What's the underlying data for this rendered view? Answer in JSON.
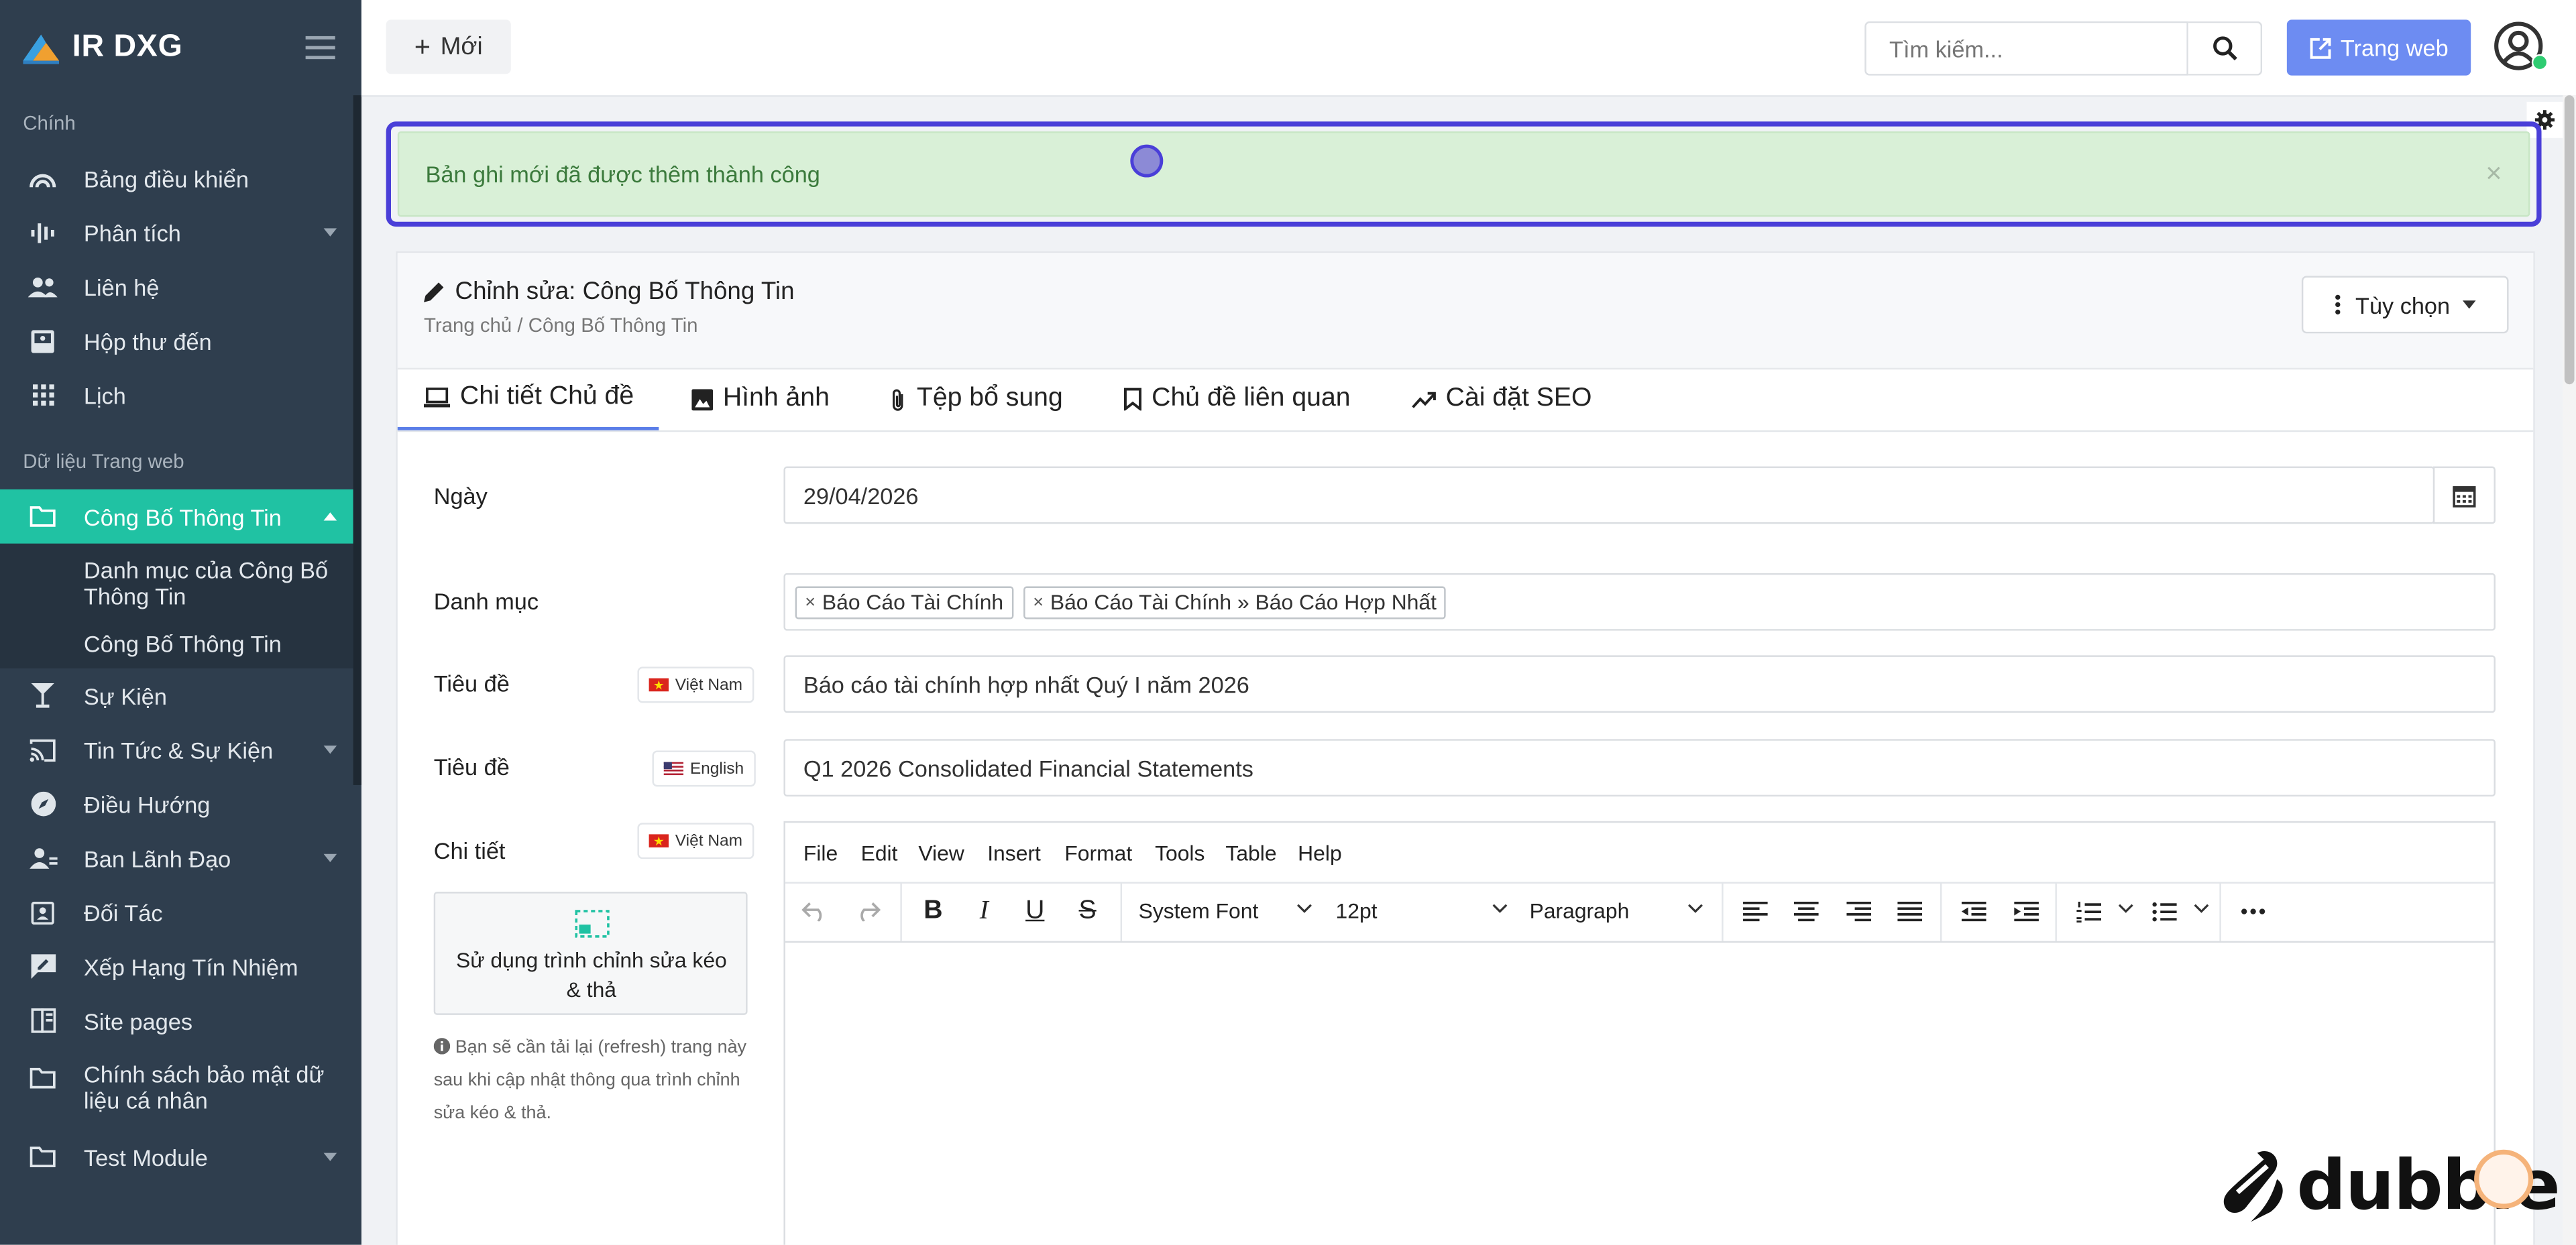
{
  "app": {
    "name": "IR DXG"
  },
  "sidebar": {
    "section_main": "Chính",
    "section_web": "Dữ liệu Trang web",
    "items": [
      {
        "label": "Bảng điều khiển",
        "icon": "dashboard-gauge-icon"
      },
      {
        "label": "Phân tích",
        "icon": "analytics-wave-icon",
        "expandable": true
      },
      {
        "label": "Liên hệ",
        "icon": "contacts-users-icon"
      },
      {
        "label": "Hộp thư đến",
        "icon": "inbox-icon"
      },
      {
        "label": "Lịch",
        "icon": "calendar-grid-icon"
      },
      {
        "label": "Công Bố Thông Tin",
        "icon": "folder-icon",
        "expandable": true,
        "active": true
      },
      {
        "label": "Sự Kiện",
        "icon": "cocktail-icon"
      },
      {
        "label": "Tin Tức & Sự Kiện",
        "icon": "cast-icon",
        "expandable": true
      },
      {
        "label": "Điều Hướng",
        "icon": "compass-icon"
      },
      {
        "label": "Ban Lãnh Đạo",
        "icon": "team-icon",
        "expandable": true
      },
      {
        "label": "Đối Tác",
        "icon": "id-card-icon"
      },
      {
        "label": "Xếp Hạng Tín Nhiệm",
        "icon": "rating-chat-icon"
      },
      {
        "label": "Site pages",
        "icon": "pages-icon"
      },
      {
        "label": "Chính sách bảo mật dữ liệu cá nhân",
        "icon": "folder-icon"
      },
      {
        "label": "Test Module",
        "icon": "folder-icon",
        "expandable": true
      }
    ],
    "sub_items": [
      {
        "label": "Danh mục của Công Bố Thông Tin"
      },
      {
        "label": "Công Bố Thông Tin"
      }
    ]
  },
  "topbar": {
    "new_label": "Mới",
    "search_placeholder": "Tìm kiếm...",
    "website_label": "Trang web"
  },
  "alert": {
    "message": "Bản ghi mới đã được thêm thành công",
    "close": "×"
  },
  "panel": {
    "title": "Chỉnh sửa: Công Bố Thông Tin",
    "breadcrumb": "Trang chủ / Công Bố Thông Tin",
    "options_label": "Tùy chọn",
    "tabs": [
      {
        "label": "Chi tiết Chủ đề",
        "icon": "laptop-icon",
        "active": true
      },
      {
        "label": "Hình ảnh",
        "icon": "image-icon"
      },
      {
        "label": "Tệp bổ sung",
        "icon": "paperclip-icon"
      },
      {
        "label": "Chủ đề liên quan",
        "icon": "bookmark-icon"
      },
      {
        "label": "Cài đặt SEO",
        "icon": "trend-up-icon"
      }
    ]
  },
  "form": {
    "date": {
      "label": "Ngày",
      "value": "29/04/2026"
    },
    "category": {
      "label": "Danh mục",
      "tags": [
        "Báo Cáo Tài Chính",
        "Báo Cáo Tài Chính » Báo Cáo Hợp Nhất"
      ]
    },
    "title_vi": {
      "label": "Tiêu đề",
      "lang": "Việt Nam",
      "value": "Báo cáo tài chính hợp nhất Quý I năm 2026"
    },
    "title_en": {
      "label": "Tiêu đề",
      "lang": "English",
      "value": "Q1 2026 Consolidated Financial Statements"
    },
    "details": {
      "label": "Chi tiết",
      "lang": "Việt Nam"
    },
    "drag_drop": {
      "button": "Sử dụng trình chỉnh sửa kéo & thả",
      "note": "Bạn sẽ cần tải lại (refresh) trang này sau khi cập nhật thông qua trình chỉnh sửa kéo & thả."
    }
  },
  "editor": {
    "menu": [
      "File",
      "Edit",
      "View",
      "Insert",
      "Format",
      "Tools",
      "Table",
      "Help"
    ],
    "font": "System Font",
    "size": "12pt",
    "block": "Paragraph"
  },
  "watermark": {
    "text": "dubble"
  },
  "colors": {
    "sidebar": "#2f3e4e",
    "active": "#20c2a3",
    "primary": "#6d8cf2",
    "alert_bg": "#d9f0d7",
    "alert_text": "#3b7a3c",
    "focus": "#4a3fd8"
  }
}
